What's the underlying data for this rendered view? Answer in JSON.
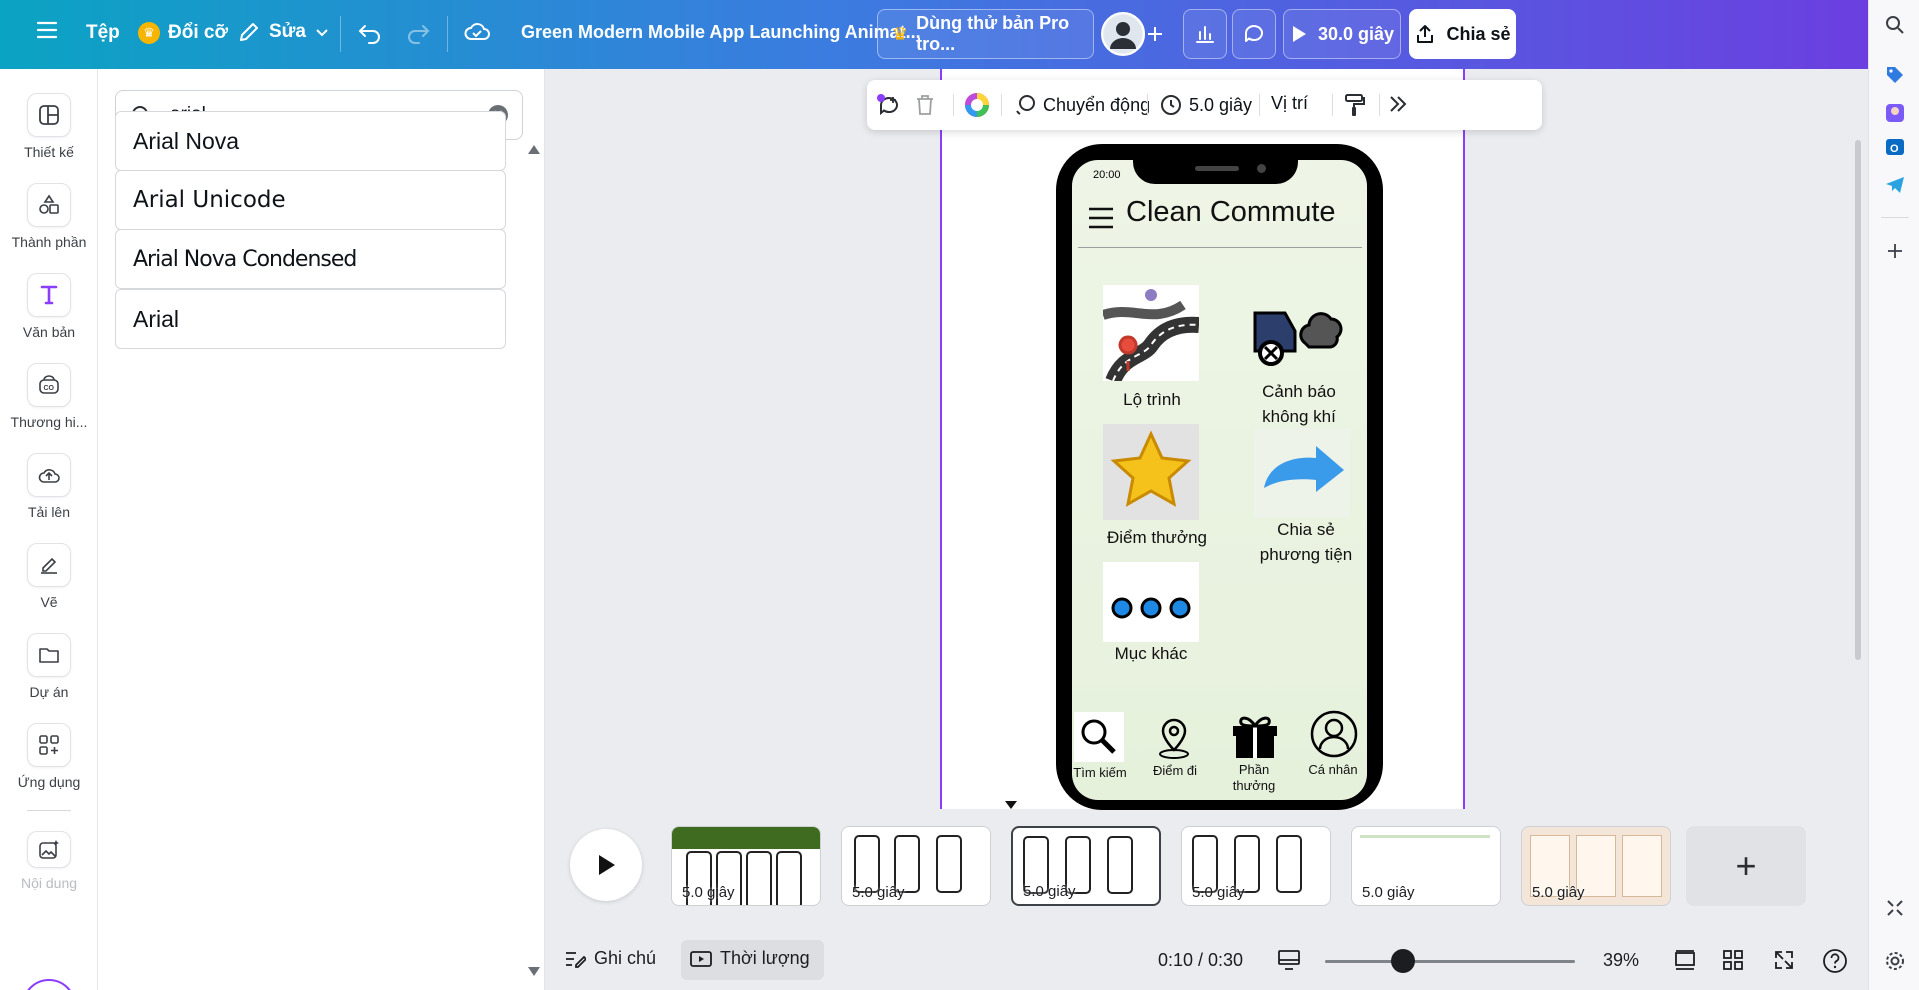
{
  "topbar": {
    "file_label": "Tệp",
    "resize_label": "Đổi cỡ",
    "edit_label": "Sửa",
    "doc_title": "Green Modern Mobile App Launching Animat...",
    "pro_label": "Dùng thử bản Pro tro...",
    "play_label": "30.0 giây",
    "share_label": "Chia sẻ",
    "accent_color": "#8b3dff"
  },
  "left_rail": {
    "items": [
      {
        "label": "Thiết kế",
        "icon": "layout-icon"
      },
      {
        "label": "Thành phần",
        "icon": "elements-icon"
      },
      {
        "label": "Văn bản",
        "icon": "text-icon"
      },
      {
        "label": "Thương hi...",
        "icon": "brand-icon"
      },
      {
        "label": "Tải lên",
        "icon": "upload-icon"
      },
      {
        "label": "Vẽ",
        "icon": "draw-icon"
      },
      {
        "label": "Dự án",
        "icon": "folder-icon"
      },
      {
        "label": "Ứng dụng",
        "icon": "apps-icon"
      },
      {
        "label": "Nội dung",
        "icon": "magic-media-icon"
      }
    ]
  },
  "panel": {
    "search_value": "arial",
    "fonts": [
      "Arial Nova",
      "Arial Unicode",
      "Arial Nova Condensed",
      "Arial"
    ]
  },
  "context_toolbar": {
    "animate_label": "Chuyển động",
    "duration_label": "5.0 giây",
    "position_label": "Vị trí"
  },
  "phone": {
    "time": "20:00",
    "app_title": "Clean Commute",
    "menu": [
      {
        "label": "Lộ trình"
      },
      {
        "label": "Cảnh báo không khí"
      },
      {
        "label": "Điểm thưởng"
      },
      {
        "label": "Chia sẻ phương tiện"
      },
      {
        "label": "Mục khác"
      }
    ],
    "nav": [
      "Tìm kiếm",
      "Điểm đi",
      "Phần thưởng",
      "Cá nhân"
    ]
  },
  "timeline": {
    "thumb_durations": [
      "5.0 giây",
      "5.0 giây",
      "5.0 giây",
      "5.0 giây",
      "5.0 giây",
      "5.0 giây"
    ],
    "selected_index": 2
  },
  "bottom_bar": {
    "notes_label": "Ghi chú",
    "duration_label": "Thời lượng",
    "time_readout": "0:10 / 0:30",
    "zoom_label": "39%",
    "zoom_level": 0.39
  }
}
